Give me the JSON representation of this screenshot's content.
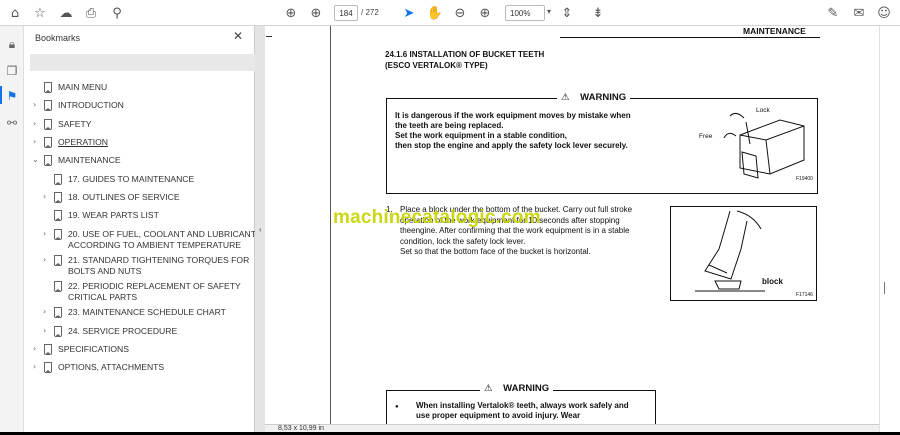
{
  "toolbar": {
    "page_current": "184",
    "page_total": "/  272",
    "zoom": "100%"
  },
  "bookmarks_panel": {
    "title": "Bookmarks",
    "items": [
      {
        "label": "MAIN MENU"
      },
      {
        "label": "INTRODUCTION"
      },
      {
        "label": "SAFETY"
      },
      {
        "label": "OPERATION"
      },
      {
        "label": "MAINTENANCE"
      },
      {
        "label": "17. GUIDES TO MAINTENANCE"
      },
      {
        "label": "18. OUTLINES OF SERVICE"
      },
      {
        "label": "19. WEAR PARTS LIST"
      },
      {
        "label_line1": "20. USE OF FUEL, COOLANT AND LUBRICANTS",
        "label_line2": "ACCORDING TO AMBIENT TEMPERATURE"
      },
      {
        "label_line1": "21. STANDARD TIGHTENING TORQUES FOR",
        "label_line2": "BOLTS AND NUTS"
      },
      {
        "label_line1": "22. PERIODIC REPLACEMENT OF SAFETY",
        "label_line2": "CRITICAL PARTS"
      },
      {
        "label": "23. MAINTENANCE SCHEDULE CHART"
      },
      {
        "label": "24. SERVICE PROCEDURE"
      },
      {
        "label": "SPECIFICATIONS"
      },
      {
        "label": "OPTIONS, ATTACHMENTS"
      }
    ]
  },
  "status_bar": {
    "page_size": "8,53 x 10,99 in"
  },
  "document": {
    "header": "MAINTENANCE",
    "section_line1": "24.1.6  INSTALLATION OF BUCKET TEETH",
    "section_line2": "(ESCO VERTALOK® TYPE)",
    "warning_label": "WARNING",
    "warning1_line1": "It is dangerous if the work equipment moves by mistake when",
    "warning1_line2": "the teeth are being replaced.",
    "warning1_line3": "Set the work equipment in a stable condition,",
    "warning1_line4": "then stop the engine and apply the safety lock lever securely.",
    "fig1_lock": "Lock",
    "fig1_free": "Free",
    "fig1_code": "F19400",
    "step_number": "1.",
    "step_line1": "Place a block under the bottom of the bucket. Carry out full stroke",
    "step_line2": "operation of the work equipment for 10 seconds after stopping",
    "step_line3": "theengine. After confirming that the work equipment is in a stable",
    "step_line4": "condition, lock the safety lock lever.",
    "step_line5": "Set so that the bottom face of the bucket is horizontal.",
    "fig2_block": "block",
    "fig2_code": "F17146",
    "warning2_bullet": "●",
    "warning2_line1": "When installing Vertalok® teeth, always work safely and",
    "warning2_line2": "use proper equipment to avoid injury. Wear"
  },
  "watermark": {
    "text": "machinecatalogic.com",
    "color": "#c8d400"
  },
  "colors": {
    "accent": "#1473e6",
    "selected_bg": "#e8e8e8"
  }
}
